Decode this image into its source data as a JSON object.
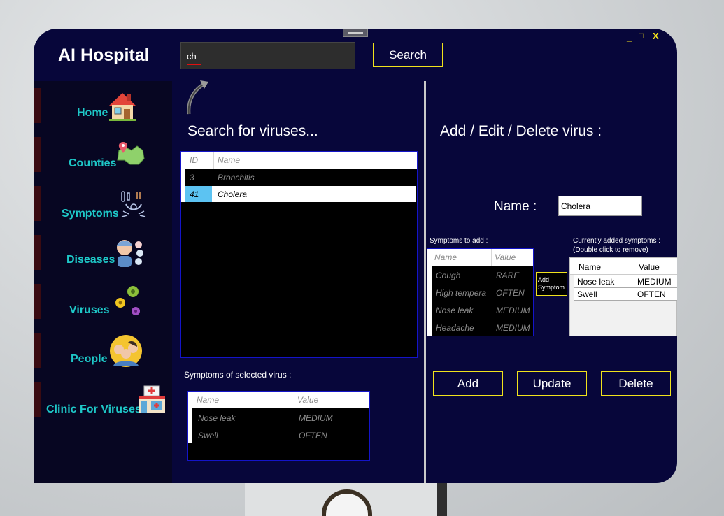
{
  "app": {
    "title": "AI Hospital",
    "window_controls": {
      "minimize": "_",
      "maximize": "□",
      "close": "X"
    }
  },
  "colors": {
    "accent": "#f0e21c",
    "nav_text": "#1ec8c8",
    "window_bg": "#07063a",
    "selected_cell": "#5cc3f2"
  },
  "search": {
    "value": "ch",
    "button_label": "Search"
  },
  "sidebar": {
    "items": [
      {
        "label": "Home",
        "icon": "house-icon"
      },
      {
        "label": "Counties",
        "icon": "map-pin-icon"
      },
      {
        "label": "Symptoms",
        "icon": "thermometer-icon"
      },
      {
        "label": "Diseases",
        "icon": "sick-person-icon"
      },
      {
        "label": "Viruses",
        "icon": "virus-icon"
      },
      {
        "label": "People",
        "icon": "people-icon"
      },
      {
        "label": "Clinic For Viruses",
        "icon": "clinic-icon"
      }
    ]
  },
  "left_panel": {
    "title": "Search for viruses...",
    "viruses_table": {
      "columns": [
        "ID",
        "Name"
      ],
      "rows": [
        {
          "id": "3",
          "name": "Bronchitis"
        },
        {
          "id": "41",
          "name": "Cholera",
          "selected": true
        }
      ]
    },
    "symptoms_label": "Symptoms of selected virus :",
    "symptoms_table": {
      "columns": [
        "Name",
        "Value"
      ],
      "rows": [
        {
          "name": "Nose leak",
          "value": "MEDIUM"
        },
        {
          "name": "Swell",
          "value": "OFTEN"
        }
      ]
    }
  },
  "right_panel": {
    "title": "Add / Edit / Delete virus :",
    "name_label": "Name :",
    "name_value": "Cholera",
    "to_add_label": "Symptoms to add :",
    "to_add_table": {
      "columns": [
        "Name",
        "Value"
      ],
      "rows": [
        {
          "name": "Cough",
          "value": "RARE"
        },
        {
          "name": "High tempera",
          "value": "OFTEN"
        },
        {
          "name": "Nose leak",
          "value": "MEDIUM"
        },
        {
          "name": "Headache",
          "value": "MEDIUM"
        }
      ]
    },
    "add_symptom_button": "Add Symptom",
    "added_label": "Currently added symptoms :",
    "added_hint": "(Double click to remove)",
    "added_table": {
      "columns": [
        "Name",
        "Value"
      ],
      "rows": [
        {
          "name": "Nose leak",
          "value": "MEDIUM"
        },
        {
          "name": "Swell",
          "value": "OFTEN"
        }
      ]
    },
    "buttons": {
      "add": "Add",
      "update": "Update",
      "delete": "Delete"
    }
  }
}
